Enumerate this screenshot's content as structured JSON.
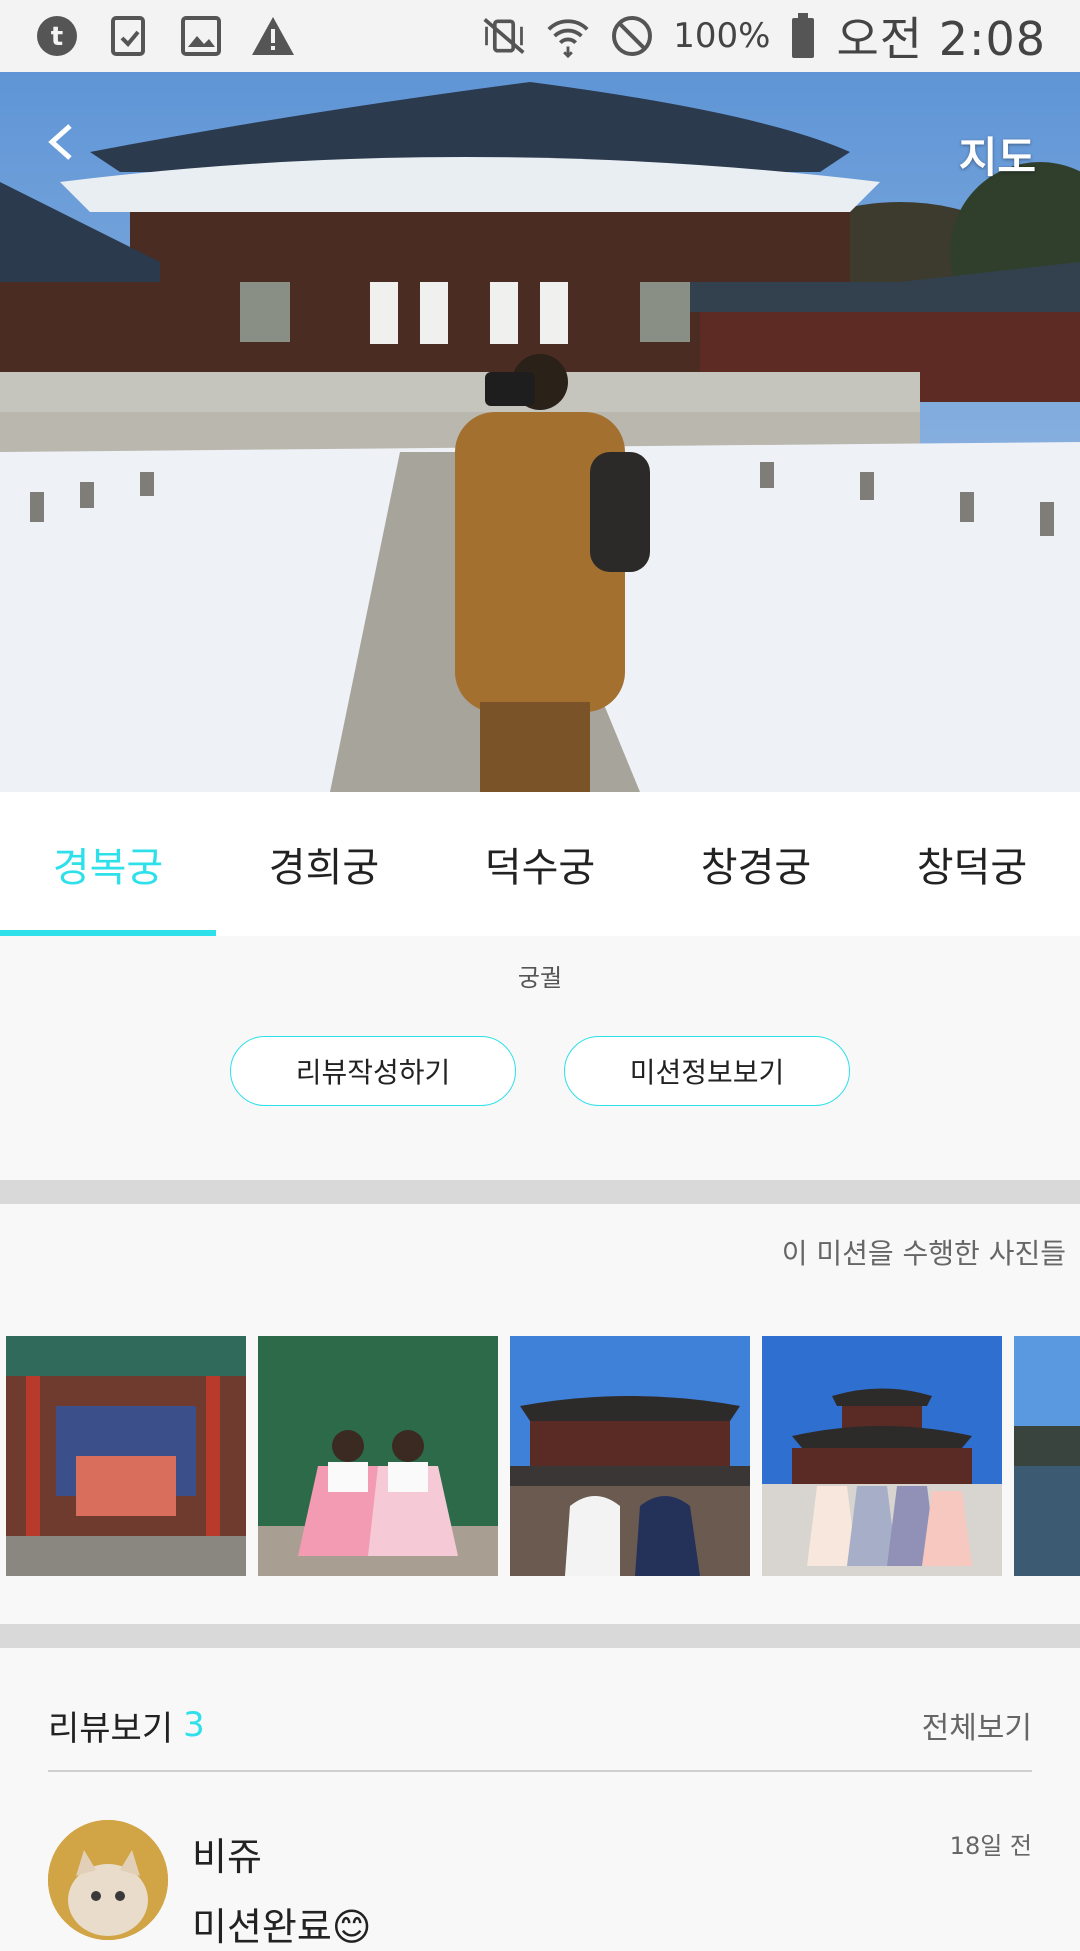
{
  "status_bar": {
    "battery": "100%",
    "time": "오전 2:08",
    "icons": [
      "tumblr-icon",
      "clipboard-check-icon",
      "image-icon",
      "warning-icon",
      "vibrate-off-icon",
      "wifi-icon",
      "do-not-disturb-icon",
      "battery-icon"
    ]
  },
  "hero": {
    "map_label": "지도",
    "back_icon": "back-arrow-icon"
  },
  "tabs": [
    {
      "label": "경복궁",
      "active": true
    },
    {
      "label": "경희궁",
      "active": false
    },
    {
      "label": "덕수궁",
      "active": false
    },
    {
      "label": "창경궁",
      "active": false
    },
    {
      "label": "창덕궁",
      "active": false
    }
  ],
  "category": "궁궐",
  "actions": {
    "write_review": "리뷰작성하기",
    "mission_info": "미션정보보기"
  },
  "photos": {
    "title": "이 미션을 수행한 사진들",
    "items": [
      "throne-room-photo",
      "hanbok-pair-photo",
      "palace-gate-photo",
      "hanbok-group-photo",
      "palace-pond-photo"
    ]
  },
  "reviews": {
    "title": "리뷰보기",
    "count": "3",
    "see_all": "전체보기",
    "items": [
      {
        "name": "비쥬",
        "time": "18일 전",
        "text": "미션완료😊"
      }
    ]
  },
  "colors": {
    "accent": "#2ee0ea",
    "divider": "#d9d9d9",
    "background": "#f8f8f8"
  }
}
